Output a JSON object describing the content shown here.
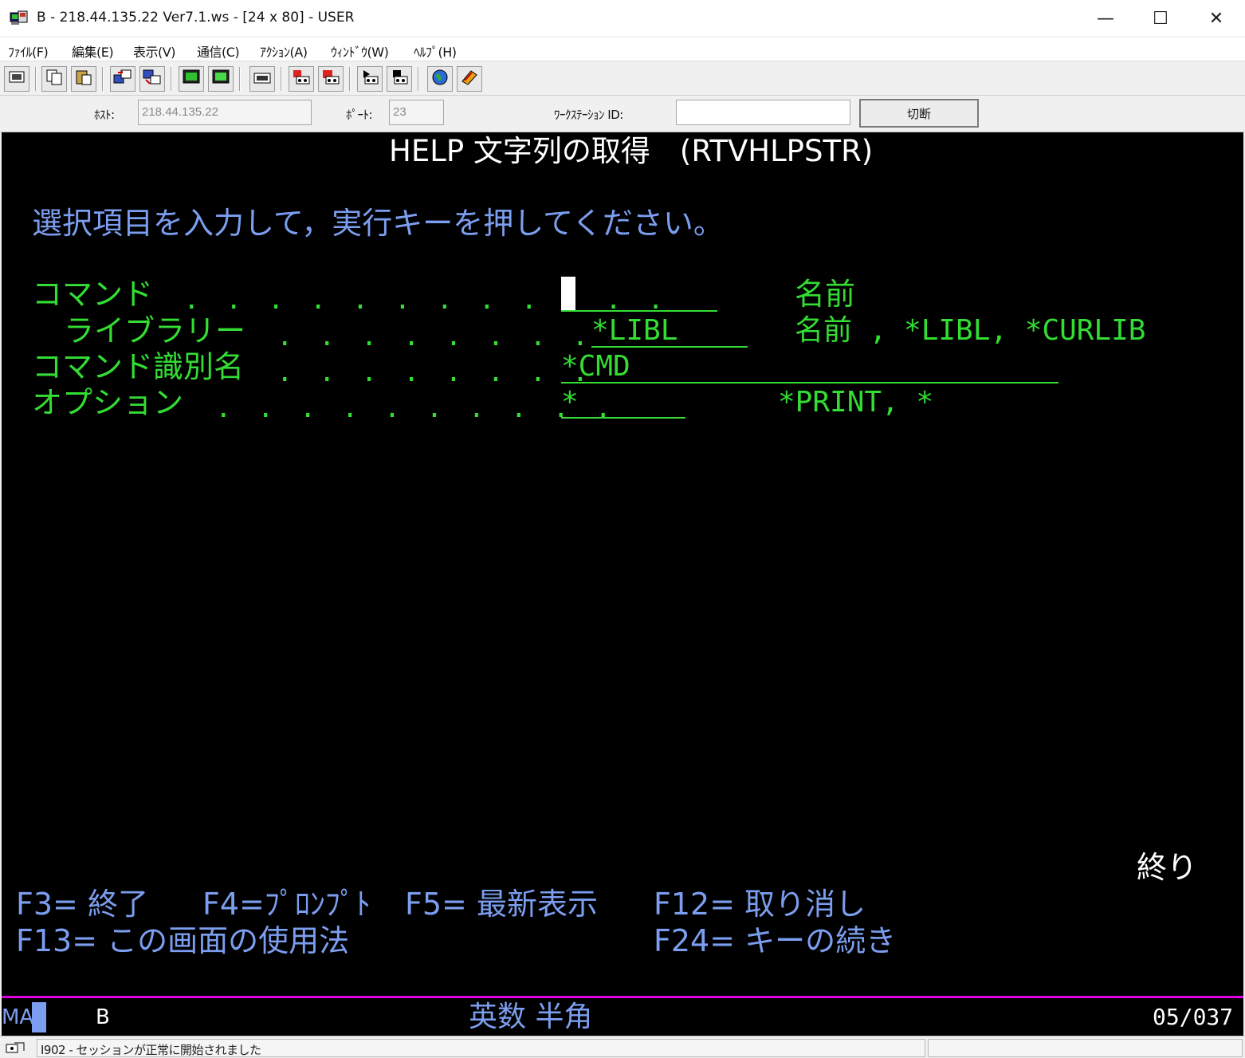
{
  "window": {
    "title": "B - 218.44.135.22 Ver7.1.ws - [24 x 80] - USER",
    "min_glyph": "—",
    "max_glyph": "☐",
    "close_glyph": "✕"
  },
  "menu": {
    "items": [
      "ﾌｧｲﾙ(F)",
      "編集(E)",
      "表示(V)",
      "通信(C)",
      "ｱｸｼｮﾝ(A)",
      "ｳｨﾝﾄﾞｳ(W)",
      "ﾍﾙﾌﾟ(H)"
    ]
  },
  "toolbar": {
    "icons": [
      "print-screen-icon",
      "copy-icon",
      "paste-icon",
      "send-file-icon",
      "receive-file-icon",
      "display-setup-icon",
      "keyboard-map-icon",
      "macro-icon",
      "record-macro-icon",
      "stop-macro-icon",
      "play-macro-icon",
      "pause-macro-icon",
      "web-icon",
      "help-book-icon"
    ]
  },
  "connection": {
    "host_label": "ﾎｽﾄ:",
    "host_value": "218.44.135.22",
    "port_label": "ﾎﾟｰﾄ:",
    "port_value": "23",
    "ws_label": "ﾜｰｸｽﾃｰｼｮﾝ ID:",
    "ws_value": "",
    "disconnect_label": "切断"
  },
  "screen": {
    "title": "HELP 文字列の取得　(RTVHLPSTR)",
    "instruction": "選択項目を入力して，実行キーを押してください。",
    "fields": [
      {
        "label": "コマンド",
        "dots": ". . . . . . . . . . . .",
        "value": "",
        "hint": "名前"
      },
      {
        "label": "ライブラリー",
        "dots": ". . . . . . . .",
        "value": "*LIBL",
        "hint": "名前 , *LIBL, *CURLIB"
      },
      {
        "label": "コマンド識別名",
        "dots": ". . . . . . . .",
        "value": "*CMD",
        "hint": ""
      },
      {
        "label": "オプション",
        "dots": ". . . . . . . . . .",
        "value": "*",
        "hint": "*PRINT, *"
      }
    ],
    "more_indicator": "終り",
    "function_keys": {
      "f3": "F3= 終了",
      "f4": "F4=ﾌﾟﾛﾝﾌﾟﾄ",
      "f5": "F5= 最新表示",
      "f12": "F12= 取り消し",
      "f13": "F13= この画面の使用法",
      "f24": "F24= キーの続き"
    }
  },
  "oia": {
    "mode": "MA",
    "session": "B",
    "input_mode": "英数 半角",
    "cursor_pos": "05/037"
  },
  "status": {
    "message": "I902 - セッションが正常に開始されました"
  },
  "colors": {
    "screen_bg": "#000000",
    "field_green": "#33dd33",
    "instruction_blue": "#7c9ef0",
    "oia_separator": "#e000e0"
  }
}
